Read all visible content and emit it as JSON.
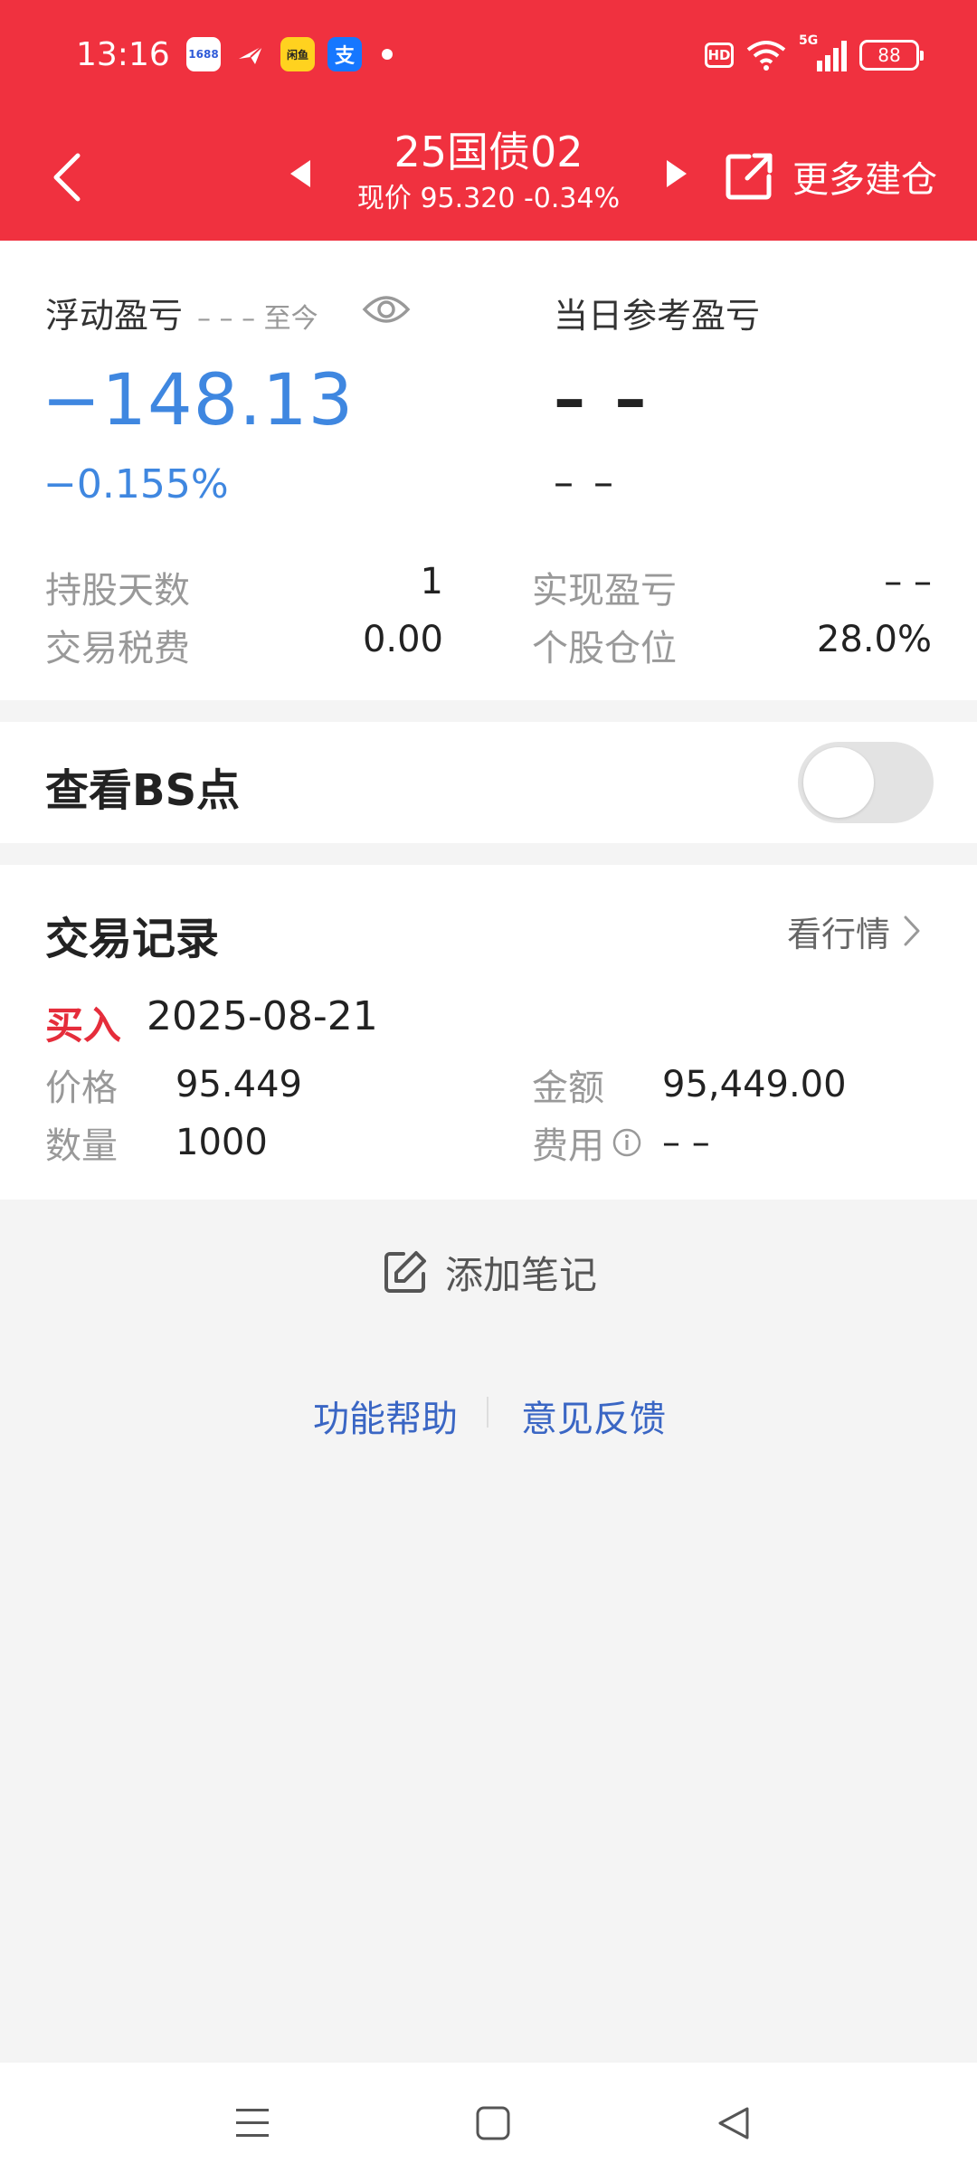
{
  "status_bar": {
    "time": "13:16",
    "apps": [
      "1688",
      "plane-app",
      "yellow-app",
      "支"
    ],
    "app_1688_label": "1688",
    "app_yellow_label": "闲鱼",
    "app_alipay_label": "支",
    "hd_label": "HD",
    "network_label": "5G",
    "battery": "88"
  },
  "header": {
    "stock_name": "25国债02",
    "price_line": "现价 95.320 -0.34%",
    "more_label": "更多建仓",
    "bg_color": "#f0313f"
  },
  "pnl": {
    "title": "浮动盈亏",
    "since": "– – – 至今",
    "value": "−148.13",
    "percent": "−0.155%",
    "value_color": "#3f87e0",
    "day_title": "当日参考盈亏",
    "day_value": "– –",
    "day_percent": "– –"
  },
  "stats": {
    "hold_days_label": "持股天数",
    "hold_days": "1",
    "realized_label": "实现盈亏",
    "realized": "– –",
    "tax_label": "交易税费",
    "tax": "0.00",
    "position_label": "个股仓位",
    "position": "28.0%"
  },
  "bs": {
    "label": "查看BS点",
    "toggle_on": false
  },
  "trades": {
    "title": "交易记录",
    "link_label": "看行情",
    "items": [
      {
        "type": "买入",
        "date": "2025-08-21",
        "price_label": "价格",
        "price": "95.449",
        "amount_label": "金额",
        "amount": "95,449.00",
        "qty_label": "数量",
        "qty": "1000",
        "fee_label": "费用",
        "fee": "– –"
      }
    ],
    "buy_color": "#e52d3b"
  },
  "note": {
    "label": "添加笔记"
  },
  "footer": {
    "help": "功能帮助",
    "feedback": "意见反馈",
    "link_color": "#3a66c4"
  },
  "nav": [
    "menu-icon",
    "home-icon",
    "back-icon"
  ]
}
